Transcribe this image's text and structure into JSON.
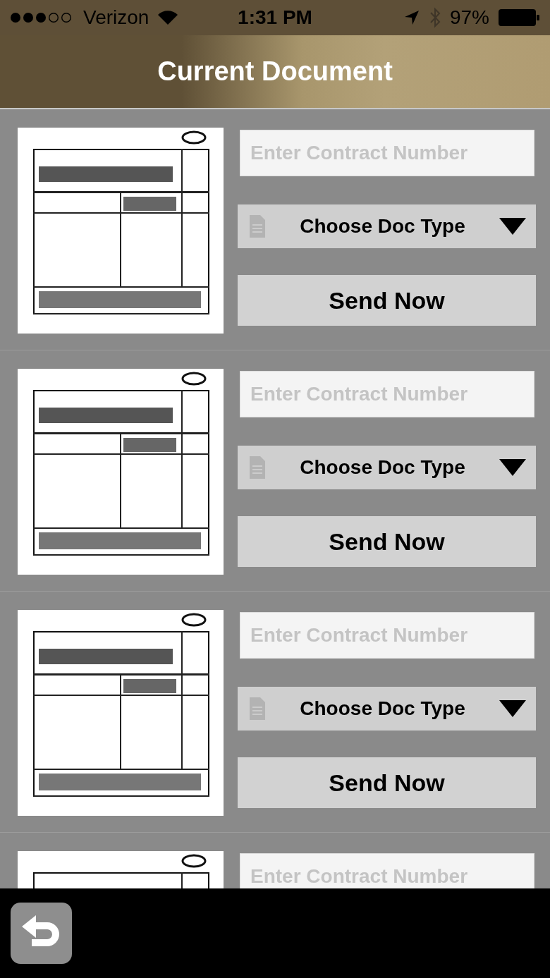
{
  "status_bar": {
    "carrier": "Verizon",
    "time": "1:31 PM",
    "battery": "97%"
  },
  "header": {
    "title": "Current Document"
  },
  "documents": [
    {
      "kind": "full",
      "placeholder": "Enter Contract Number",
      "doc_type": "Choose Doc Type",
      "send": "Send Now"
    },
    {
      "kind": "full",
      "placeholder": "Enter Contract Number",
      "doc_type": "Choose Doc Type",
      "send": "Send Now"
    },
    {
      "kind": "full",
      "placeholder": "Enter Contract Number",
      "doc_type": "Choose Doc Type",
      "send": "Send Now"
    },
    {
      "kind": "partial",
      "placeholder": "Enter Contract Number"
    }
  ]
}
